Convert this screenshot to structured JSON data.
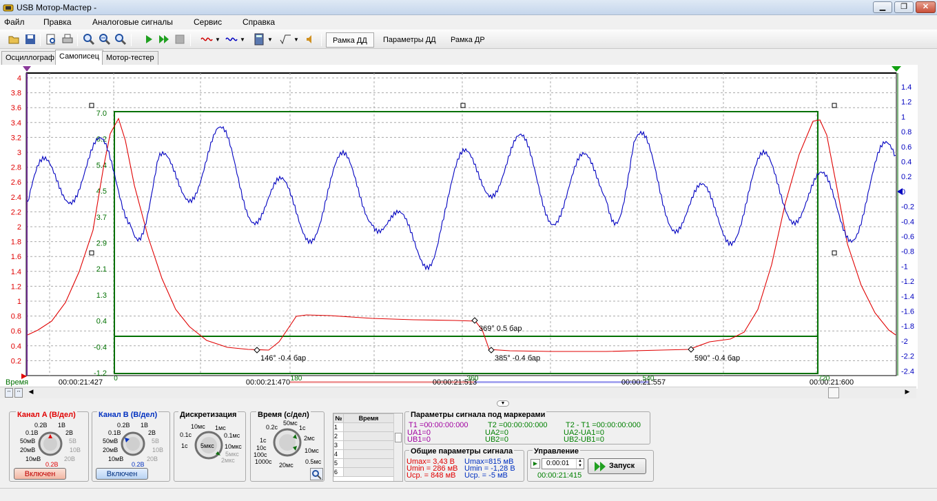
{
  "window": {
    "title": "USB Мотор-Мастер -",
    "min": "▁",
    "max": "❐",
    "close": "✕"
  },
  "menu": [
    "Файл",
    "Правка",
    "Аналоговые сигналы",
    "Сервис",
    "Справка"
  ],
  "toolbar": {
    "text_buttons": [
      "Рамка ДД",
      "Параметры ДД",
      "Рамка ДР"
    ]
  },
  "tabs": [
    "Осциллограф",
    "Самописец",
    "Мотор-тестер"
  ],
  "plot": {
    "left_axis": [
      "4",
      "3.8",
      "3.6",
      "3.4",
      "3.2",
      "3",
      "2.8",
      "2.6",
      "2.4",
      "2.2",
      "2",
      "1.8",
      "1.6",
      "1.4",
      "1.2",
      "1",
      "0.8",
      "0.6",
      "0.4",
      "0.2"
    ],
    "inner_axis": [
      "7.0",
      "6.2",
      "5.4",
      "4.5",
      "3.7",
      "2.9",
      "2.1",
      "1.3",
      "0.4",
      "-0.4",
      "-1.2"
    ],
    "right_axis": [
      "1.4",
      "1.2",
      "1",
      "0.8",
      "0.6",
      "0.4",
      "0.2",
      "0",
      "-0.2",
      "-0.4",
      "-0.6",
      "-0.8",
      "-1",
      "-1.2",
      "-1.4",
      "-1.6",
      "-1.8",
      "-2",
      "-2.2",
      "-2.4"
    ],
    "time_label": "Время",
    "time_ticks": [
      "00:00:21:427",
      "00:00:21:470",
      "00:00:21:513",
      "00:00:21:557",
      "00:00:21:600"
    ],
    "angle_ticks": [
      "0",
      "180",
      "360",
      "540",
      "720"
    ],
    "annotations": [
      "369° 0.5 бар",
      "146° -0.4 бар",
      "385° -0.4 бар",
      "590° -0.4 бар"
    ],
    "colors": {
      "channel_a": "#e00000",
      "channel_b": "#0000c0",
      "frame": "#007000"
    }
  },
  "channel_a": {
    "title": "Канал A (В/дел)",
    "labels": [
      "0.2В",
      "1В",
      "0.1В",
      "2В",
      "50мВ",
      "5В",
      "20мВ",
      "10В",
      "10мВ",
      "20В"
    ],
    "value": "0.2В",
    "button": "Включен"
  },
  "channel_b": {
    "title": "Канал B (В/дел)",
    "labels": [
      "0.2В",
      "1В",
      "0.1В",
      "2В",
      "50мВ",
      "5В",
      "20мВ",
      "10В",
      "10мВ",
      "20В"
    ],
    "value": "0.2В",
    "button": "Включен"
  },
  "sampling": {
    "title": "Дискретизация",
    "labels": [
      "10мс",
      "1мс",
      "0.1с",
      "0.1мс",
      "1с",
      "10мкс",
      "5мкс",
      "2мкс"
    ],
    "value": "5мкс"
  },
  "time_div": {
    "title": "Время (с/дел)",
    "labels": [
      "50мс",
      "0.2с",
      "1с",
      "2мс",
      "1с",
      "10с",
      "100с",
      "1000с",
      "0.5мс",
      "10мс",
      "20мс"
    ]
  },
  "markers_table": {
    "col_num": "№",
    "col_time": "Время",
    "rows": [
      "1",
      "2",
      "3",
      "4",
      "5",
      "6"
    ]
  },
  "marker_params": {
    "title": "Параметры сигнала под маркерами",
    "t1": "T1 =00:00:00:000",
    "t2": "T2 =00:00:00:000",
    "dt": "T2 - T1 =00:00:00:000",
    "ua1": "UA1=0",
    "ua2": "UA2=0",
    "dua": "UA2-UA1=0",
    "ub1": "UB1=0",
    "ub2": "UB2=0",
    "dub": "UB2-UB1=0"
  },
  "common_params": {
    "title": "Общие параметры сигнала",
    "a": [
      "Umax= 3,43 В",
      "Umin = 286 мВ",
      "Uср. = 848 мВ"
    ],
    "b": [
      "Umax=815 мВ",
      "Umin = -1,28 В",
      "Uср. =  -5 мВ"
    ]
  },
  "control": {
    "title": "Управление",
    "time_value": "0:00:01",
    "clock": "00:00:21:415",
    "start": "Запуск"
  }
}
